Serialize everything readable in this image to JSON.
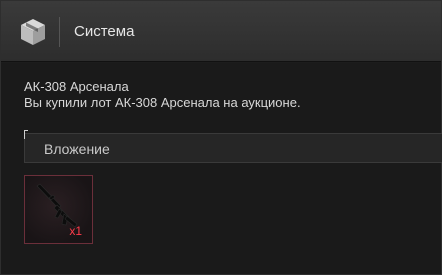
{
  "header": {
    "title": "Система",
    "icon": "box-icon"
  },
  "message": {
    "lot_name": "АК-308 Арсенала",
    "text": "Вы купили лот АК-308 Арсенала на аукционе."
  },
  "attachment": {
    "label": "Вложение",
    "item": {
      "icon": "rifle-icon",
      "quantity": "x1"
    }
  }
}
